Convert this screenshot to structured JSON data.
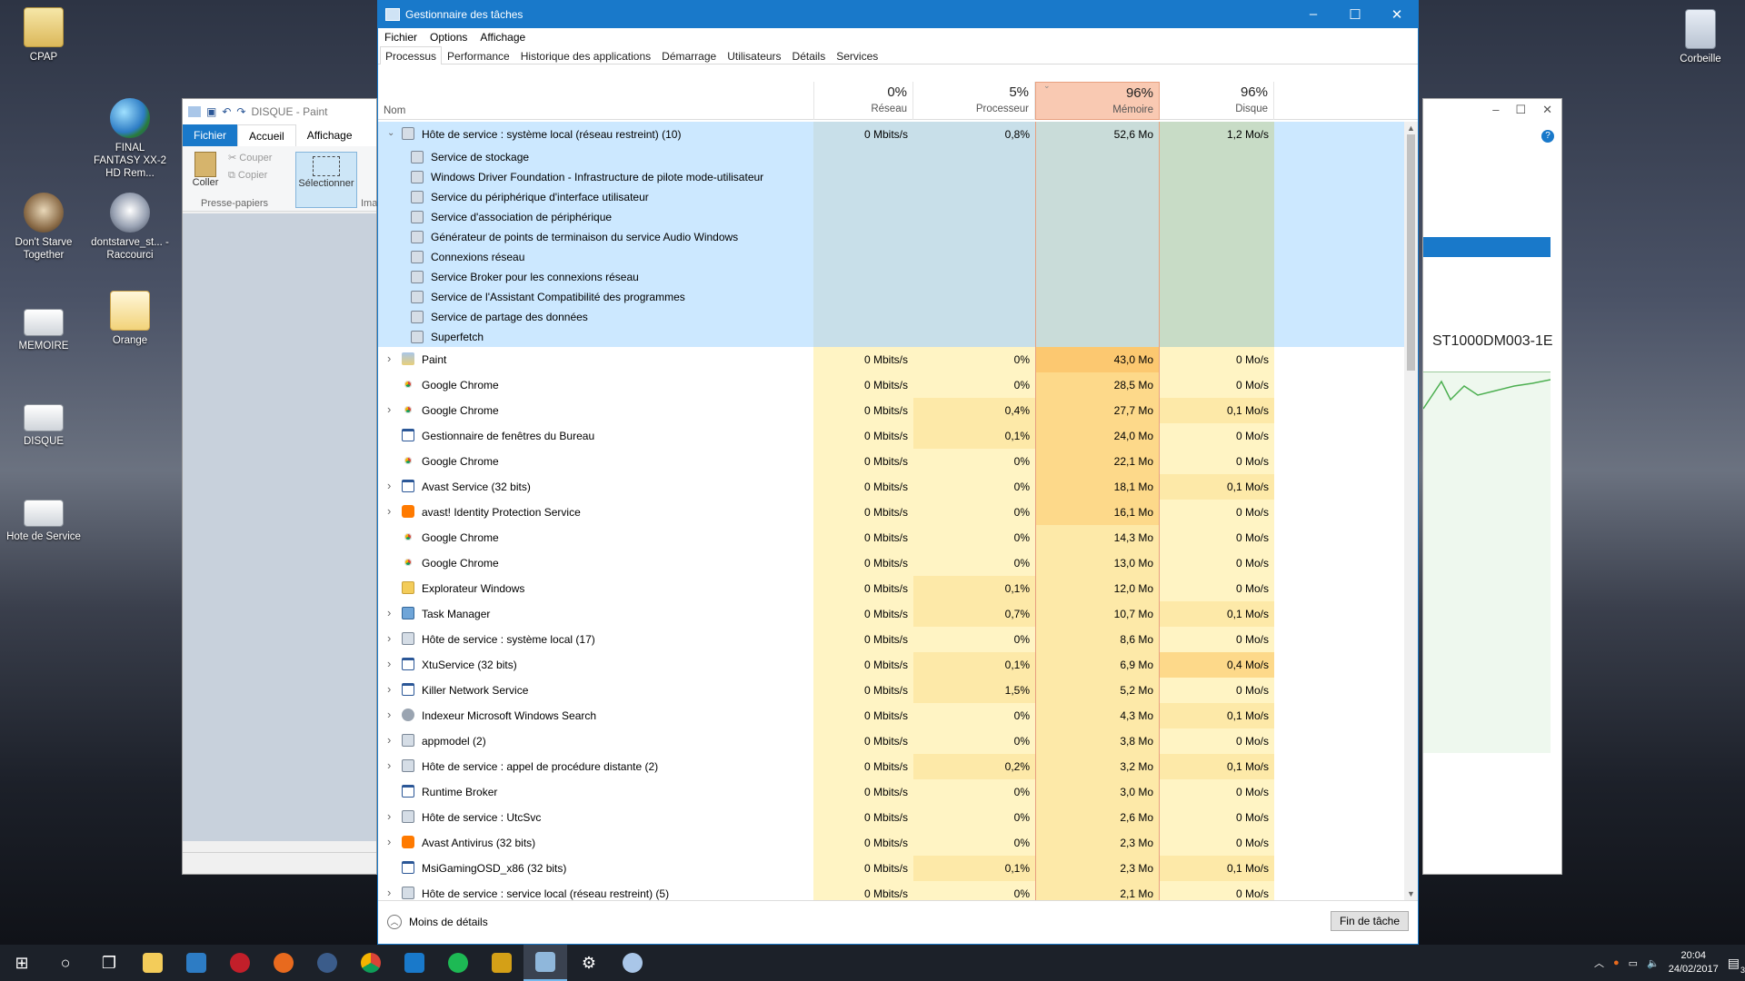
{
  "desktop": {
    "icons_left": [
      {
        "label": "CPAP",
        "kind": "folder"
      },
      {
        "label": "FINAL FANTASY XX-2 HD Rem...",
        "kind": "globe"
      },
      {
        "label": "Don't Starve Together",
        "kind": "face"
      },
      {
        "label": "dontstarve_st... - Raccourci",
        "kind": "face2"
      },
      {
        "label": "MEMOIRE",
        "kind": "drive"
      },
      {
        "label": "Orange",
        "kind": "orange"
      },
      {
        "label": "DISQUE",
        "kind": "drive"
      },
      {
        "label": "Hote de Service",
        "kind": "drive"
      }
    ],
    "icons_mid": [
      {
        "label": "CPAP",
        "kind": "folder"
      },
      {
        "label": "Hote de Service",
        "kind": "drive"
      },
      {
        "label": "FINAL FANTASY XX-2 HD Rem...",
        "kind": "globe"
      },
      {
        "label": "Don't Starve Together",
        "kind": "face"
      },
      {
        "label": "dontstarve_st... - Raccourci",
        "kind": "face2"
      },
      {
        "label": "MEMOIRE",
        "kind": "drive"
      },
      {
        "label": "Orange",
        "kind": "orange"
      }
    ],
    "recycle_bin": "Corbeille"
  },
  "paint": {
    "title": "DISQUE - Paint",
    "tabs": [
      "Fichier",
      "Accueil",
      "Affichage"
    ],
    "coller": "Coller",
    "couper": "Couper",
    "copier": "Copier",
    "selectionner": "Sélectionner",
    "group": "Presse-papiers",
    "ima": "Ima"
  },
  "right_window": {
    "disk_label": "ST1000DM003-1E"
  },
  "taskmgr": {
    "title": "Gestionnaire des tâches",
    "menu": [
      "Fichier",
      "Options",
      "Affichage"
    ],
    "tabs": [
      "Processus",
      "Performance",
      "Historique des applications",
      "Démarrage",
      "Utilisateurs",
      "Détails",
      "Services"
    ],
    "active_tab": "Processus",
    "columns": {
      "name": "Nom",
      "net_pct": "0%",
      "net": "Réseau",
      "cpu_pct": "5%",
      "cpu": "Processeur",
      "mem_pct": "96%",
      "mem": "Mémoire",
      "disk_pct": "96%",
      "disk": "Disque"
    },
    "group": {
      "name": "Hôte de service : système local (réseau restreint) (10)",
      "net": "0 Mbits/s",
      "cpu": "0,8%",
      "mem": "52,6 Mo",
      "disk": "1,2 Mo/s",
      "children": [
        "Service de stockage",
        "Windows Driver Foundation - Infrastructure de pilote mode-utilisateur",
        "Service du périphérique d'interface utilisateur",
        "Service d'association de périphérique",
        "Générateur de points de terminaison du service Audio Windows",
        "Connexions réseau",
        "Service Broker pour les connexions réseau",
        "Service de l'Assistant Compatibilité des programmes",
        "Service de partage des données",
        "Superfetch"
      ]
    },
    "rows": [
      {
        "name": "Paint",
        "icon": "paint",
        "exp": true,
        "net": "0 Mbits/s",
        "cpu": "0%",
        "mem": "43,0 Mo",
        "disk": "0 Mo/s",
        "cpu_h": 0,
        "mem_h": 3,
        "disk_h": 0
      },
      {
        "name": "Google Chrome",
        "icon": "chrome",
        "exp": false,
        "net": "0 Mbits/s",
        "cpu": "0%",
        "mem": "28,5 Mo",
        "disk": "0 Mo/s",
        "cpu_h": 0,
        "mem_h": 2,
        "disk_h": 0
      },
      {
        "name": "Google Chrome",
        "icon": "chrome",
        "exp": true,
        "net": "0 Mbits/s",
        "cpu": "0,4%",
        "mem": "27,7 Mo",
        "disk": "0,1 Mo/s",
        "cpu_h": 1,
        "mem_h": 2,
        "disk_h": 1
      },
      {
        "name": "Gestionnaire de fenêtres du Bureau",
        "icon": "win",
        "exp": false,
        "net": "0 Mbits/s",
        "cpu": "0,1%",
        "mem": "24,0 Mo",
        "disk": "0 Mo/s",
        "cpu_h": 1,
        "mem_h": 2,
        "disk_h": 0
      },
      {
        "name": "Google Chrome",
        "icon": "chrome",
        "exp": false,
        "net": "0 Mbits/s",
        "cpu": "0%",
        "mem": "22,1 Mo",
        "disk": "0 Mo/s",
        "cpu_h": 0,
        "mem_h": 2,
        "disk_h": 0
      },
      {
        "name": "Avast Service (32 bits)",
        "icon": "win",
        "exp": true,
        "net": "0 Mbits/s",
        "cpu": "0%",
        "mem": "18,1 Mo",
        "disk": "0,1 Mo/s",
        "cpu_h": 0,
        "mem_h": 2,
        "disk_h": 1
      },
      {
        "name": "avast! Identity Protection Service",
        "icon": "avast",
        "exp": true,
        "net": "0 Mbits/s",
        "cpu": "0%",
        "mem": "16,1 Mo",
        "disk": "0 Mo/s",
        "cpu_h": 0,
        "mem_h": 2,
        "disk_h": 0
      },
      {
        "name": "Google Chrome",
        "icon": "chrome",
        "exp": false,
        "net": "0 Mbits/s",
        "cpu": "0%",
        "mem": "14,3 Mo",
        "disk": "0 Mo/s",
        "cpu_h": 0,
        "mem_h": 1,
        "disk_h": 0
      },
      {
        "name": "Google Chrome",
        "icon": "chrome",
        "exp": false,
        "net": "0 Mbits/s",
        "cpu": "0%",
        "mem": "13,0 Mo",
        "disk": "0 Mo/s",
        "cpu_h": 0,
        "mem_h": 1,
        "disk_h": 0
      },
      {
        "name": "Explorateur Windows",
        "icon": "folder",
        "exp": false,
        "net": "0 Mbits/s",
        "cpu": "0,1%",
        "mem": "12,0 Mo",
        "disk": "0 Mo/s",
        "cpu_h": 1,
        "mem_h": 1,
        "disk_h": 0
      },
      {
        "name": "Task Manager",
        "icon": "tm",
        "exp": true,
        "net": "0 Mbits/s",
        "cpu": "0,7%",
        "mem": "10,7 Mo",
        "disk": "0,1 Mo/s",
        "cpu_h": 1,
        "mem_h": 1,
        "disk_h": 1
      },
      {
        "name": "Hôte de service : système local (17)",
        "icon": "gear",
        "exp": true,
        "net": "0 Mbits/s",
        "cpu": "0%",
        "mem": "8,6 Mo",
        "disk": "0 Mo/s",
        "cpu_h": 0,
        "mem_h": 1,
        "disk_h": 0
      },
      {
        "name": "XtuService (32 bits)",
        "icon": "win",
        "exp": true,
        "net": "0 Mbits/s",
        "cpu": "0,1%",
        "mem": "6,9 Mo",
        "disk": "0,4 Mo/s",
        "cpu_h": 1,
        "mem_h": 1,
        "disk_h": 2
      },
      {
        "name": "Killer Network Service",
        "icon": "win",
        "exp": true,
        "net": "0 Mbits/s",
        "cpu": "1,5%",
        "mem": "5,2 Mo",
        "disk": "0 Mo/s",
        "cpu_h": 1,
        "mem_h": 1,
        "disk_h": 0
      },
      {
        "name": "Indexeur Microsoft Windows Search",
        "icon": "search",
        "exp": true,
        "net": "0 Mbits/s",
        "cpu": "0%",
        "mem": "4,3 Mo",
        "disk": "0,1 Mo/s",
        "cpu_h": 0,
        "mem_h": 1,
        "disk_h": 1
      },
      {
        "name": "appmodel (2)",
        "icon": "gear",
        "exp": true,
        "net": "0 Mbits/s",
        "cpu": "0%",
        "mem": "3,8 Mo",
        "disk": "0 Mo/s",
        "cpu_h": 0,
        "mem_h": 1,
        "disk_h": 0
      },
      {
        "name": "Hôte de service : appel de procédure distante (2)",
        "icon": "gear",
        "exp": true,
        "net": "0 Mbits/s",
        "cpu": "0,2%",
        "mem": "3,2 Mo",
        "disk": "0,1 Mo/s",
        "cpu_h": 1,
        "mem_h": 1,
        "disk_h": 1
      },
      {
        "name": "Runtime Broker",
        "icon": "win",
        "exp": false,
        "net": "0 Mbits/s",
        "cpu": "0%",
        "mem": "3,0 Mo",
        "disk": "0 Mo/s",
        "cpu_h": 0,
        "mem_h": 1,
        "disk_h": 0
      },
      {
        "name": "Hôte de service : UtcSvc",
        "icon": "gear",
        "exp": true,
        "net": "0 Mbits/s",
        "cpu": "0%",
        "mem": "2,6 Mo",
        "disk": "0 Mo/s",
        "cpu_h": 0,
        "mem_h": 1,
        "disk_h": 0
      },
      {
        "name": "Avast Antivirus (32 bits)",
        "icon": "avast",
        "exp": true,
        "net": "0 Mbits/s",
        "cpu": "0%",
        "mem": "2,3 Mo",
        "disk": "0 Mo/s",
        "cpu_h": 0,
        "mem_h": 1,
        "disk_h": 0
      },
      {
        "name": "MsiGamingOSD_x86 (32 bits)",
        "icon": "win",
        "exp": false,
        "net": "0 Mbits/s",
        "cpu": "0,1%",
        "mem": "2,3 Mo",
        "disk": "0,1 Mo/s",
        "cpu_h": 1,
        "mem_h": 1,
        "disk_h": 1
      },
      {
        "name": "Hôte de service : service local (réseau restreint) (5)",
        "icon": "gear",
        "exp": true,
        "net": "0 Mbits/s",
        "cpu": "0%",
        "mem": "2,1 Mo",
        "disk": "0 Mo/s",
        "cpu_h": 0,
        "mem_h": 1,
        "disk_h": 0
      }
    ],
    "heat_colors": [
      "#fff4c4",
      "#fde9a8",
      "#fdd98a",
      "#fcc870"
    ],
    "less_details": "Moins de détails",
    "end_task": "Fin de tâche"
  },
  "taskbar": {
    "time": "20:04",
    "date": "24/02/2017",
    "notif_count": "3"
  }
}
